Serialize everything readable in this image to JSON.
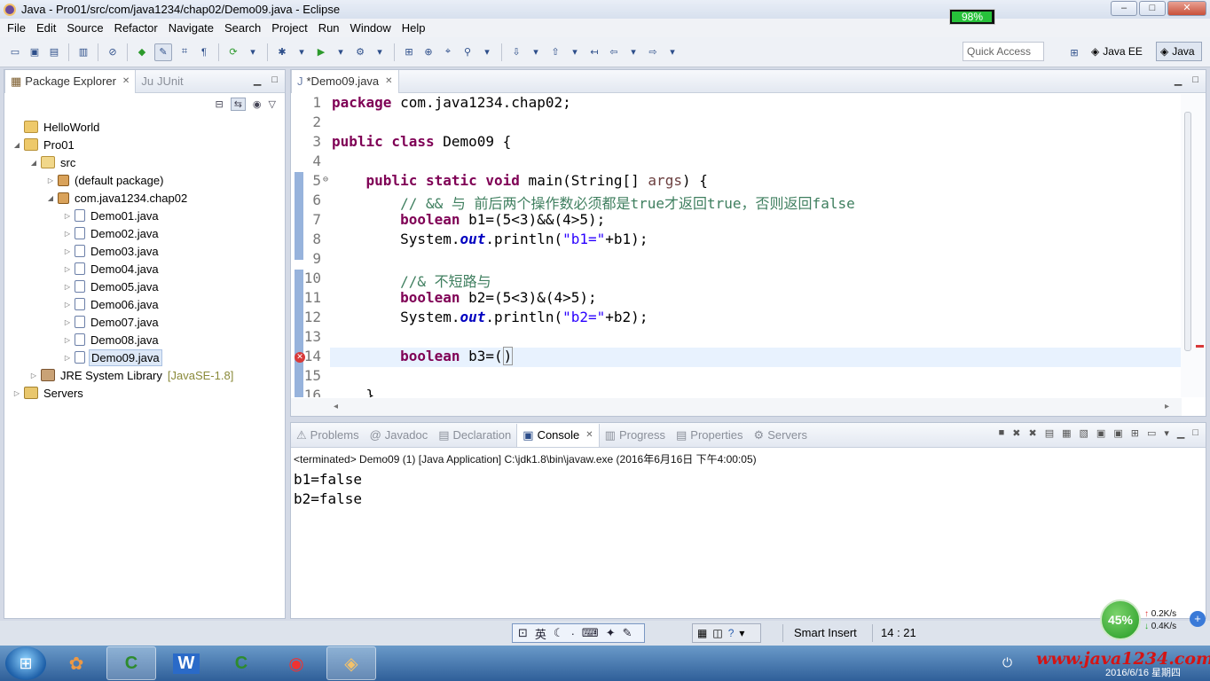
{
  "window": {
    "title": "Java - Pro01/src/com/java1234/chap02/Demo09.java - Eclipse",
    "minimize": "–",
    "maximize": "□",
    "close": "✕"
  },
  "menu": [
    "File",
    "Edit",
    "Source",
    "Refactor",
    "Navigate",
    "Search",
    "Project",
    "Run",
    "Window",
    "Help"
  ],
  "toolbar": {
    "quick_access": "Quick Access",
    "perspective_javaee": "Java EE",
    "perspective_java": "Java"
  },
  "package_explorer": {
    "tab_label": "Package Explorer",
    "junit_label": "JUnit",
    "tree": [
      {
        "label": "HelloWorld",
        "depth": 0,
        "icon": "project-icon"
      },
      {
        "label": "Pro01",
        "depth": 0,
        "icon": "project-icon",
        "expanded": true
      },
      {
        "label": "src",
        "depth": 1,
        "icon": "source-folder-icon",
        "expanded": true
      },
      {
        "label": "(default package)",
        "depth": 2,
        "icon": "package-icon"
      },
      {
        "label": "com.java1234.chap02",
        "depth": 2,
        "icon": "package-icon",
        "expanded": true
      },
      {
        "label": "Demo01.java",
        "depth": 3,
        "icon": "java-file-icon"
      },
      {
        "label": "Demo02.java",
        "depth": 3,
        "icon": "java-file-icon"
      },
      {
        "label": "Demo03.java",
        "depth": 3,
        "icon": "java-file-icon"
      },
      {
        "label": "Demo04.java",
        "depth": 3,
        "icon": "java-file-icon"
      },
      {
        "label": "Demo05.java",
        "depth": 3,
        "icon": "java-file-icon"
      },
      {
        "label": "Demo06.java",
        "depth": 3,
        "icon": "java-file-icon"
      },
      {
        "label": "Demo07.java",
        "depth": 3,
        "icon": "java-file-icon"
      },
      {
        "label": "Demo08.java",
        "depth": 3,
        "icon": "java-file-icon"
      },
      {
        "label": "Demo09.java",
        "depth": 3,
        "icon": "java-file-icon",
        "selected": true
      },
      {
        "label": "JRE System Library",
        "decoration": "[JavaSE-1.8]",
        "depth": 1,
        "icon": "library-icon"
      },
      {
        "label": "Servers",
        "depth": 0,
        "icon": "folder-icon"
      }
    ]
  },
  "editor": {
    "tab_label": "*Demo09.java",
    "line_numbers": [
      "1",
      "2",
      "3",
      "4",
      "5",
      "6",
      "7",
      "8",
      "9",
      "10",
      "11",
      "12",
      "13",
      "14",
      "15",
      "16"
    ],
    "lines": {
      "l1_kw": "package",
      "l1_rest": " com.java1234.chap02;",
      "l3_kw": "public class",
      "l3_rest": " Demo09 {",
      "l5_kw": "public static void",
      "l5_mid": " main(String[] ",
      "l5_param": "args",
      "l5_end": ") {",
      "l6_comment": "// && 与 前后两个操作数必须都是true才返回true，否则返回false",
      "l7_kw": "boolean",
      "l7_rest": " b1=(5<3)&&(4>5);",
      "l8_a": "System.",
      "l8_field": "out",
      "l8_b": ".println(",
      "l8_str": "\"b1=\"",
      "l8_c": "+b1);",
      "l10_comment": "//& 不短路与",
      "l11_kw": "boolean",
      "l11_rest": " b2=(5<3)&(4>5);",
      "l12_a": "System.",
      "l12_field": "out",
      "l12_b": ".println(",
      "l12_str": "\"b2=\"",
      "l12_c": "+b2);",
      "l14_kw": "boolean",
      "l14_rest": " b3=(",
      "l14_close": ")",
      "l16_rest": "}"
    }
  },
  "console": {
    "tabs": [
      "Problems",
      "Javadoc",
      "Declaration",
      "Console",
      "Progress",
      "Properties",
      "Servers"
    ],
    "active_tab": "Console",
    "header": "<terminated> Demo09 (1) [Java Application] C:\\jdk1.8\\bin\\javaw.exe (2016年6月16日 下午4:00:05)",
    "output": [
      "b1=false",
      "b2=false"
    ]
  },
  "status": {
    "mode": "Smart Insert",
    "position": "14 : 21",
    "ime_lang": "英"
  },
  "netmon": {
    "percent": "45%",
    "up": "0.2K/s",
    "down": "0.4K/s",
    "plus": "+"
  },
  "taskbar": {
    "battery": "98%",
    "battery_level": 0.98,
    "watermark": "www.java1234.com",
    "date": "2016/6/16 星期四"
  },
  "colors": {
    "keyword": "#7f0055",
    "comment": "#3f7f5f",
    "string": "#2a00ff",
    "field": "#0000c0",
    "error": "#d83a3a"
  }
}
